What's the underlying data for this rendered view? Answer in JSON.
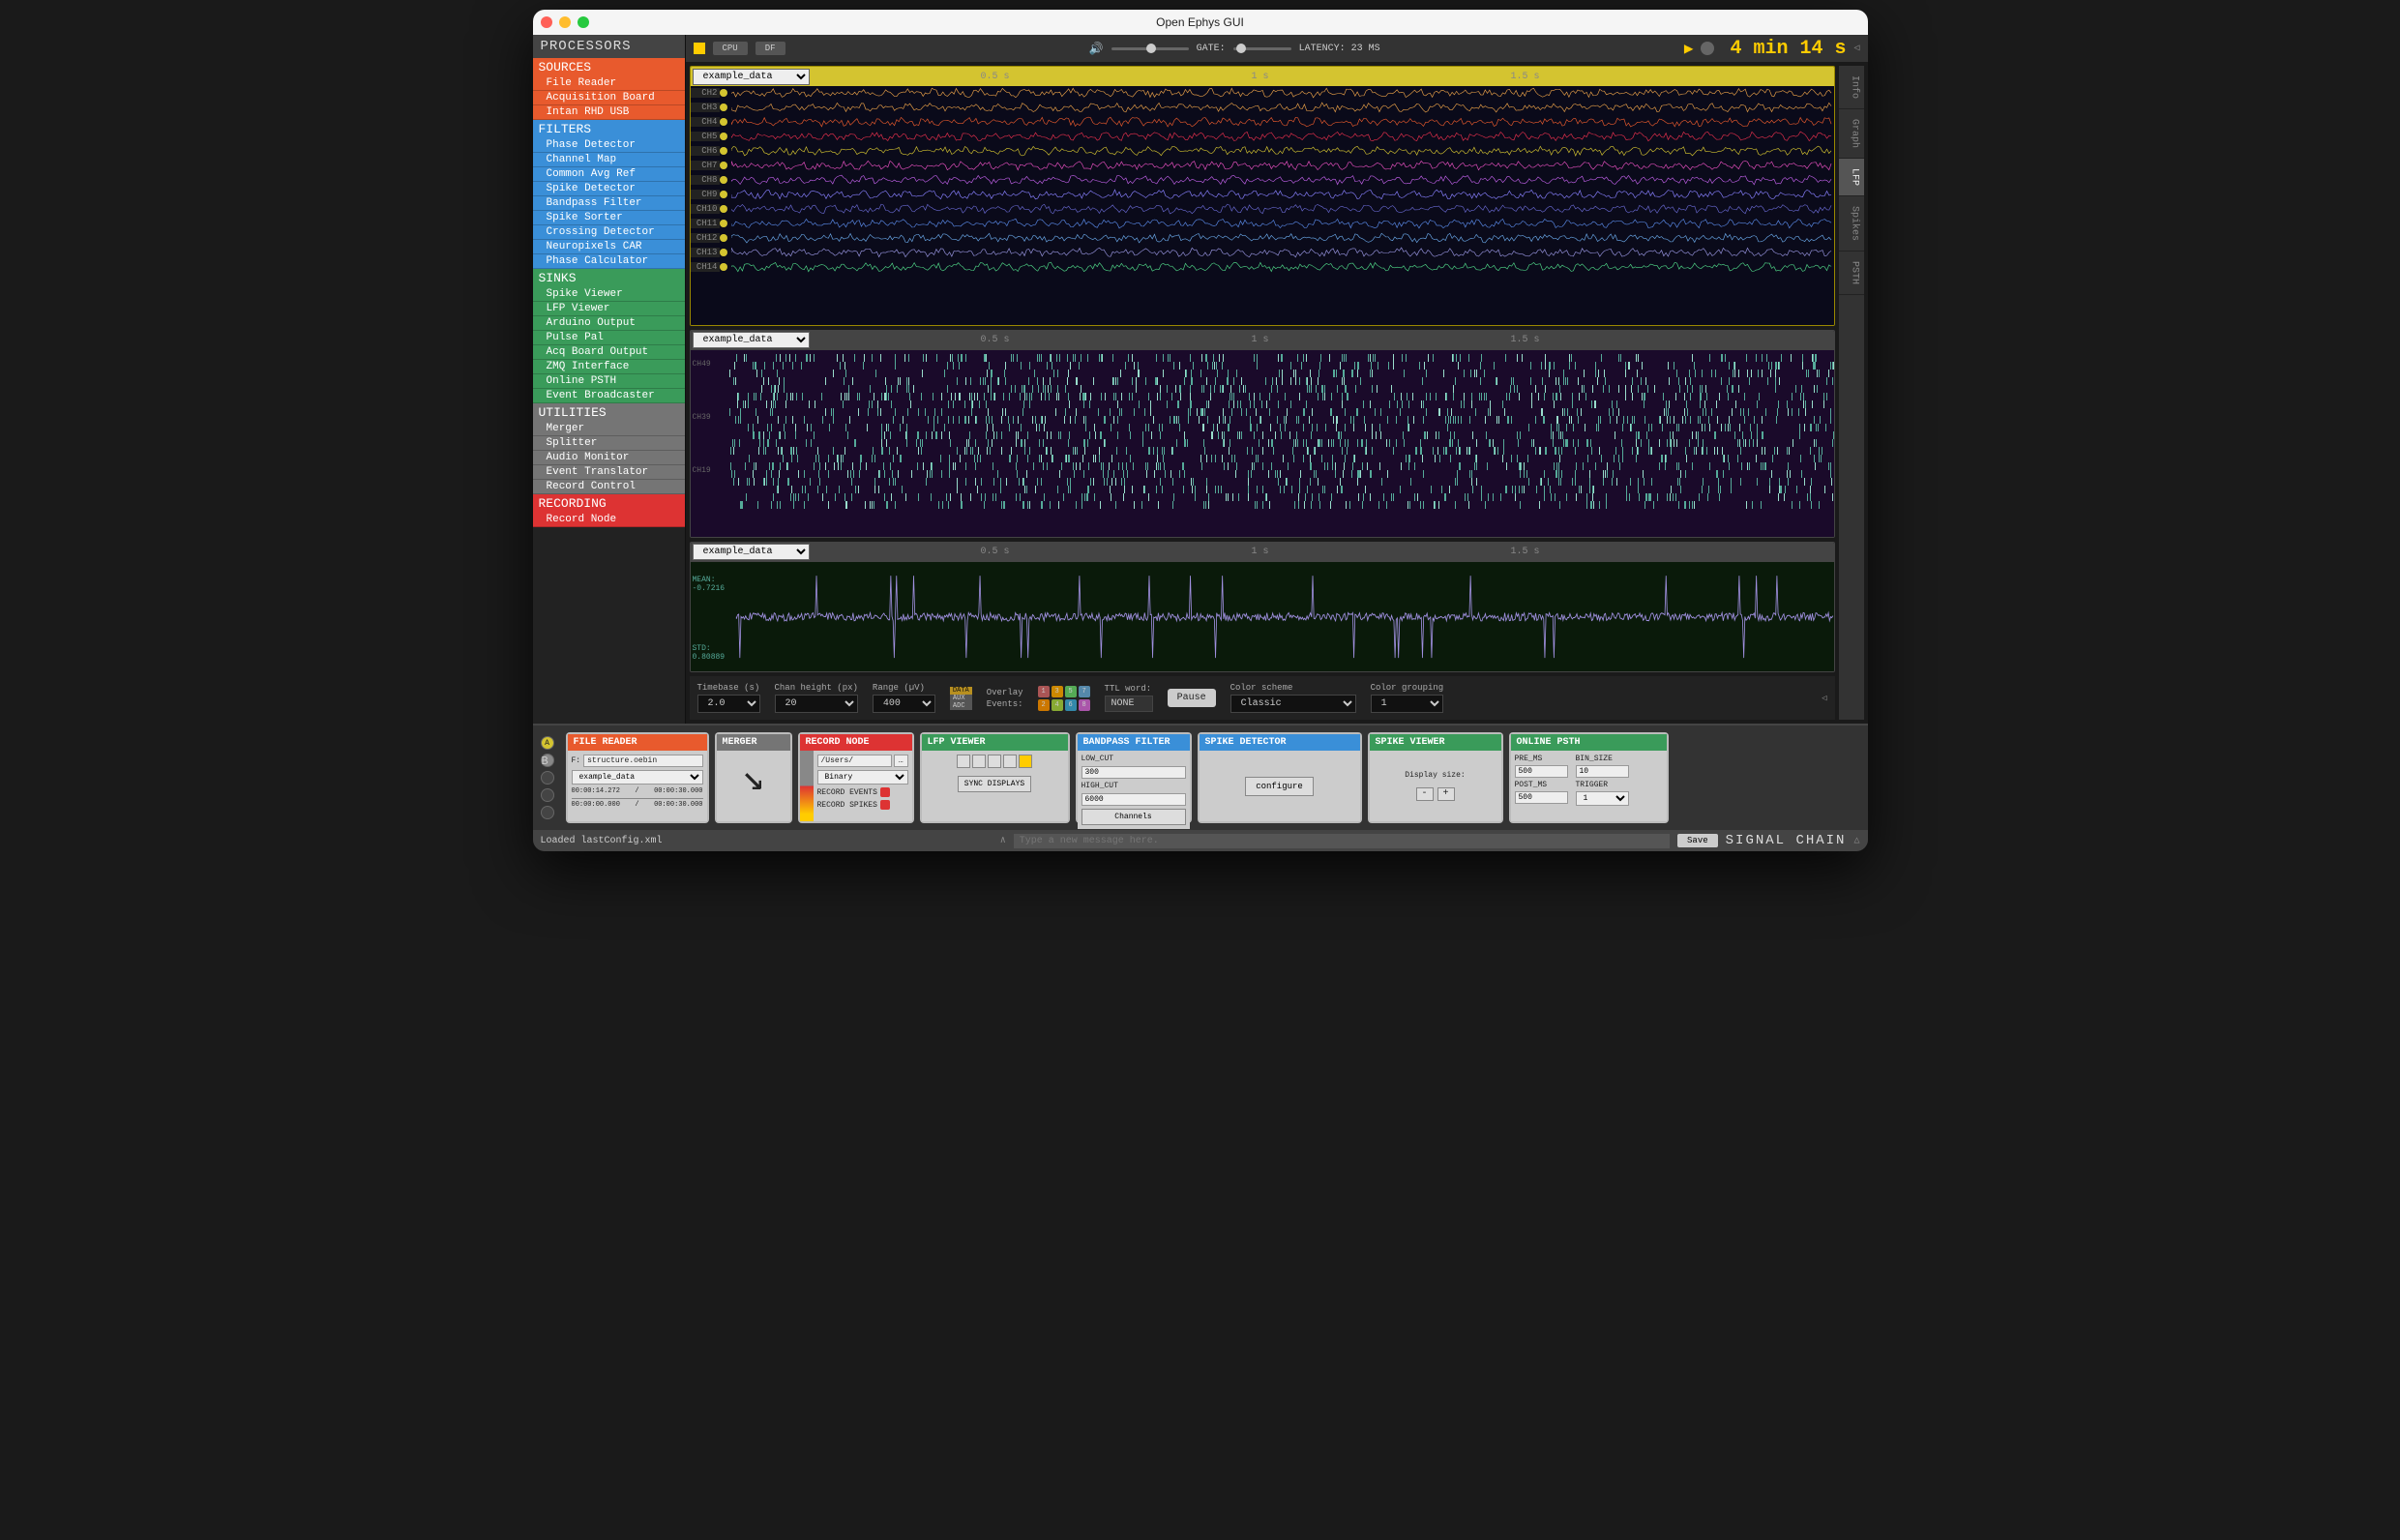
{
  "window": {
    "title": "Open Ephys GUI"
  },
  "sidebar": {
    "header": "PROCESSORS",
    "sources": {
      "label": "SOURCES",
      "items": [
        "File Reader",
        "Acquisition Board",
        "Intan RHD USB"
      ]
    },
    "filters": {
      "label": "FILTERS",
      "items": [
        "Phase Detector",
        "Channel Map",
        "Common Avg Ref",
        "Spike Detector",
        "Bandpass Filter",
        "Spike Sorter",
        "Crossing Detector",
        "Neuropixels CAR",
        "Phase Calculator"
      ]
    },
    "sinks": {
      "label": "SINKS",
      "items": [
        "Spike Viewer",
        "LFP Viewer",
        "Arduino Output",
        "Pulse Pal",
        "Acq Board Output",
        "ZMQ Interface",
        "Online PSTH",
        "Event Broadcaster"
      ]
    },
    "utilities": {
      "label": "UTILITIES",
      "items": [
        "Merger",
        "Splitter",
        "Audio Monitor",
        "Event Translator",
        "Record Control"
      ]
    },
    "recording": {
      "label": "RECORDING",
      "items": [
        "Record Node"
      ]
    }
  },
  "topbar": {
    "cpu": "CPU",
    "df": "DF",
    "gate": "GATE:",
    "latency": "LATENCY: 23 MS",
    "timer": "4 min 14 s"
  },
  "viewers": {
    "stream_select": "example_data",
    "time_marks": [
      "0.5 s",
      "1 s",
      "1.5 s"
    ],
    "channels": [
      "CH2",
      "CH3",
      "CH4",
      "CH5",
      "CH6",
      "CH7",
      "CH8",
      "CH9",
      "CH10",
      "CH11",
      "CH12",
      "CH13",
      "CH14"
    ],
    "mean_label": "MEAN:",
    "mean_value": "-0.7216",
    "std_label": "STD:",
    "std_value": "0.80889"
  },
  "bottom": {
    "timebase": {
      "label": "Timebase (s)",
      "value": "2.0"
    },
    "chanheight": {
      "label": "Chan height (px)",
      "value": "20"
    },
    "range": {
      "label": "Range (µV)",
      "value": "400"
    },
    "badges": [
      "DATA",
      "AUX",
      "ADC"
    ],
    "overlay": "Overlay",
    "events": "Events:",
    "ttl": {
      "label": "TTL word:",
      "value": "NONE"
    },
    "pause": "Pause",
    "colorscheme": {
      "label": "Color scheme",
      "value": "Classic"
    },
    "colorgroup": {
      "label": "Color grouping",
      "value": "1"
    }
  },
  "sidetabs": [
    "Info",
    "Graph",
    "LFP",
    "Spikes",
    "PSTH"
  ],
  "chain": {
    "filereader": {
      "title": "FILE READER",
      "f": "F:",
      "file": "structure.oebin",
      "stream": "example_data",
      "t1": "00:00:14.272",
      "t2": "00:00:30.000",
      "t1b": "00:00:00.000",
      "t2b": "00:00:30.000"
    },
    "merger": {
      "title": "MERGER"
    },
    "recordnode": {
      "title": "RECORD NODE",
      "path": "/Users/",
      "format": "Binary",
      "ev": "RECORD EVENTS",
      "sp": "RECORD SPIKES"
    },
    "lfp": {
      "title": "LFP VIEWER",
      "sync": "SYNC DISPLAYS"
    },
    "bandpass": {
      "title": "BANDPASS FILTER",
      "low": "LOW_CUT",
      "lowv": "300",
      "high": "HIGH_CUT",
      "highv": "6000",
      "chan": "Channels"
    },
    "spikedet": {
      "title": "SPIKE DETECTOR",
      "cfg": "configure"
    },
    "spikeview": {
      "title": "SPIKE VIEWER",
      "ds": "Display size:"
    },
    "psth": {
      "title": "ONLINE PSTH",
      "pre": "PRE_MS",
      "prev": "500",
      "bin": "BIN_SIZE",
      "binv": "10",
      "post": "POST_MS",
      "postv": "500",
      "trig": "TRIGGER",
      "trigv": "1"
    }
  },
  "status": {
    "loaded": "Loaded lastConfig.xml",
    "placeholder": "Type a new message here.",
    "save": "Save",
    "signal_chain": "SIGNAL CHAIN"
  },
  "colors": {
    "waves": [
      "#e8a048",
      "#e8a048",
      "#e85a2d",
      "#e8304d",
      "#d4c430",
      "#e850c0",
      "#c060e8",
      "#8880ff",
      "#6868d0",
      "#5a8ae8",
      "#6aa8e8",
      "#9895e0",
      "#50d888"
    ]
  }
}
